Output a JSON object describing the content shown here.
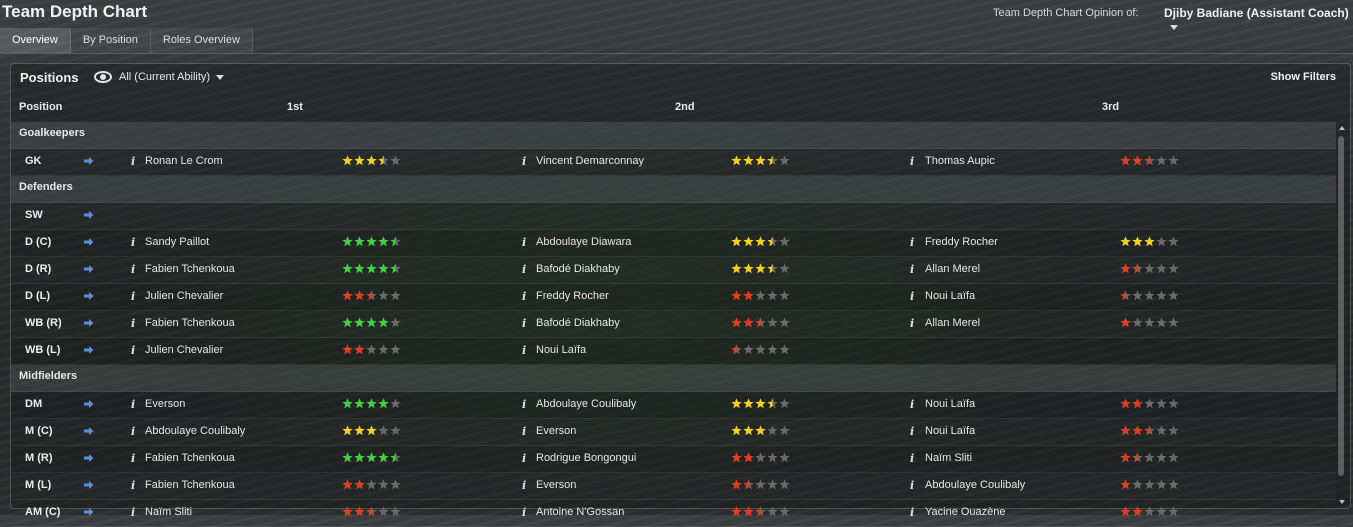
{
  "header": {
    "title": "Team Depth Chart",
    "opinion_label": "Team Depth Chart Opinion of:",
    "opinion_value": "Djiby Badiane (Assistant Coach)"
  },
  "tabs": [
    {
      "label": "Overview",
      "active": true
    },
    {
      "label": "By Position",
      "active": false
    },
    {
      "label": "Roles Overview",
      "active": false
    }
  ],
  "panel": {
    "title": "Positions",
    "view_filter": "All (Current Ability)",
    "show_filters": "Show Filters"
  },
  "columns": {
    "position": "Position",
    "first": "1st",
    "second": "2nd",
    "third": "3rd"
  },
  "colors": {
    "green": "#3fd23f",
    "yellow": "#f3d21b",
    "red": "#e83a1e",
    "empty": "#6a6a6a"
  },
  "groups": [
    {
      "name": "Goalkeepers",
      "rows": [
        {
          "pos": "GK",
          "players": [
            {
              "name": "Ronan Le Crom",
              "stars": 3.5,
              "color": "yellow"
            },
            {
              "name": "Vincent Demarconnay",
              "stars": 3.5,
              "color": "yellow"
            },
            {
              "name": "Thomas Aupic",
              "stars": 2.5,
              "color": "red"
            }
          ]
        }
      ]
    },
    {
      "name": "Defenders",
      "rows": [
        {
          "pos": "SW",
          "players": []
        },
        {
          "pos": "D (C)",
          "players": [
            {
              "name": "Sandy Paillot",
              "stars": 4.5,
              "color": "green"
            },
            {
              "name": "Abdoulaye Diawara",
              "stars": 3.5,
              "color": "yellow"
            },
            {
              "name": "Freddy Rocher",
              "stars": 3,
              "color": "yellow"
            }
          ]
        },
        {
          "pos": "D (R)",
          "players": [
            {
              "name": "Fabien Tchenkoua",
              "stars": 4.5,
              "color": "green"
            },
            {
              "name": "Bafodé Diakhaby",
              "stars": 3.5,
              "color": "yellow"
            },
            {
              "name": "Allan Merel",
              "stars": 1.5,
              "color": "red"
            }
          ]
        },
        {
          "pos": "D (L)",
          "players": [
            {
              "name": "Julien Chevalier",
              "stars": 2.5,
              "color": "red"
            },
            {
              "name": "Freddy Rocher",
              "stars": 2,
              "color": "red"
            },
            {
              "name": "Noui Laïfa",
              "stars": 0.5,
              "color": "red"
            }
          ]
        },
        {
          "pos": "WB (R)",
          "players": [
            {
              "name": "Fabien Tchenkoua",
              "stars": 4,
              "color": "green"
            },
            {
              "name": "Bafodé Diakhaby",
              "stars": 2.5,
              "color": "red"
            },
            {
              "name": "Allan Merel",
              "stars": 1,
              "color": "red"
            }
          ]
        },
        {
          "pos": "WB (L)",
          "players": [
            {
              "name": "Julien Chevalier",
              "stars": 2,
              "color": "red"
            },
            {
              "name": "Noui Laïfa",
              "stars": 0.5,
              "color": "red"
            }
          ]
        }
      ]
    },
    {
      "name": "Midfielders",
      "rows": [
        {
          "pos": "DM",
          "players": [
            {
              "name": "Everson",
              "stars": 4,
              "color": "green"
            },
            {
              "name": "Abdoulaye Coulibaly",
              "stars": 3.5,
              "color": "yellow"
            },
            {
              "name": "Noui Laïfa",
              "stars": 2,
              "color": "red"
            }
          ]
        },
        {
          "pos": "M (C)",
          "players": [
            {
              "name": "Abdoulaye Coulibaly",
              "stars": 3,
              "color": "yellow"
            },
            {
              "name": "Everson",
              "stars": 3,
              "color": "yellow"
            },
            {
              "name": "Noui Laïfa",
              "stars": 2.5,
              "color": "red"
            }
          ]
        },
        {
          "pos": "M (R)",
          "players": [
            {
              "name": "Fabien Tchenkoua",
              "stars": 4.5,
              "color": "green"
            },
            {
              "name": "Rodrigue Bongongui",
              "stars": 2,
              "color": "red"
            },
            {
              "name": "Naïm Sliti",
              "stars": 1.5,
              "color": "red"
            }
          ]
        },
        {
          "pos": "M (L)",
          "players": [
            {
              "name": "Fabien Tchenkoua",
              "stars": 2,
              "color": "red"
            },
            {
              "name": "Everson",
              "stars": 1.5,
              "color": "red"
            },
            {
              "name": "Abdoulaye Coulibaly",
              "stars": 1,
              "color": "red"
            }
          ]
        },
        {
          "pos": "AM (C)",
          "players": [
            {
              "name": "Naïm Sliti",
              "stars": 2.5,
              "color": "red"
            },
            {
              "name": "Antoine N'Gossan",
              "stars": 2.5,
              "color": "red"
            },
            {
              "name": "Yacine Ouazène",
              "stars": 2,
              "color": "red"
            }
          ]
        }
      ]
    }
  ]
}
